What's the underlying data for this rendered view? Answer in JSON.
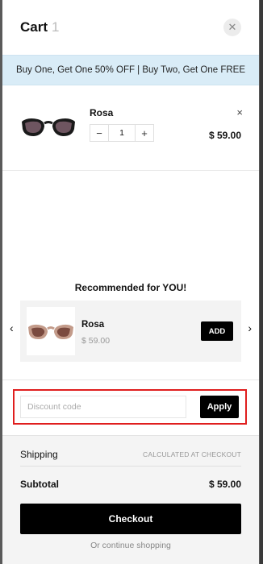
{
  "header": {
    "title": "Cart",
    "count": "1",
    "close_icon": "close-icon"
  },
  "promo": {
    "text": "Buy One, Get One 50% OFF | Buy Two, Get One FREE"
  },
  "cart_items": [
    {
      "name": "Rosa",
      "quantity": "1",
      "price": "$ 59.00",
      "minus": "−",
      "plus": "+",
      "remove": "×"
    }
  ],
  "recommendations": {
    "title": "Recommended for YOU!",
    "prev_icon": "chevron-left-icon",
    "next_icon": "chevron-right-icon",
    "items": [
      {
        "name": "Rosa",
        "price": "$ 59.00",
        "add_label": "ADD"
      }
    ]
  },
  "discount": {
    "placeholder": "Discount code",
    "value": "",
    "apply_label": "Apply"
  },
  "summary": {
    "shipping_label": "Shipping",
    "shipping_value": "CALCULATED AT CHECKOUT",
    "subtotal_label": "Subtotal",
    "subtotal_value": "$ 59.00"
  },
  "actions": {
    "checkout_label": "Checkout",
    "continue_label": "Or continue shopping"
  },
  "colors": {
    "accent": "#000000",
    "promo_bg": "#d9ecf7",
    "highlight": "#e01e1e"
  }
}
